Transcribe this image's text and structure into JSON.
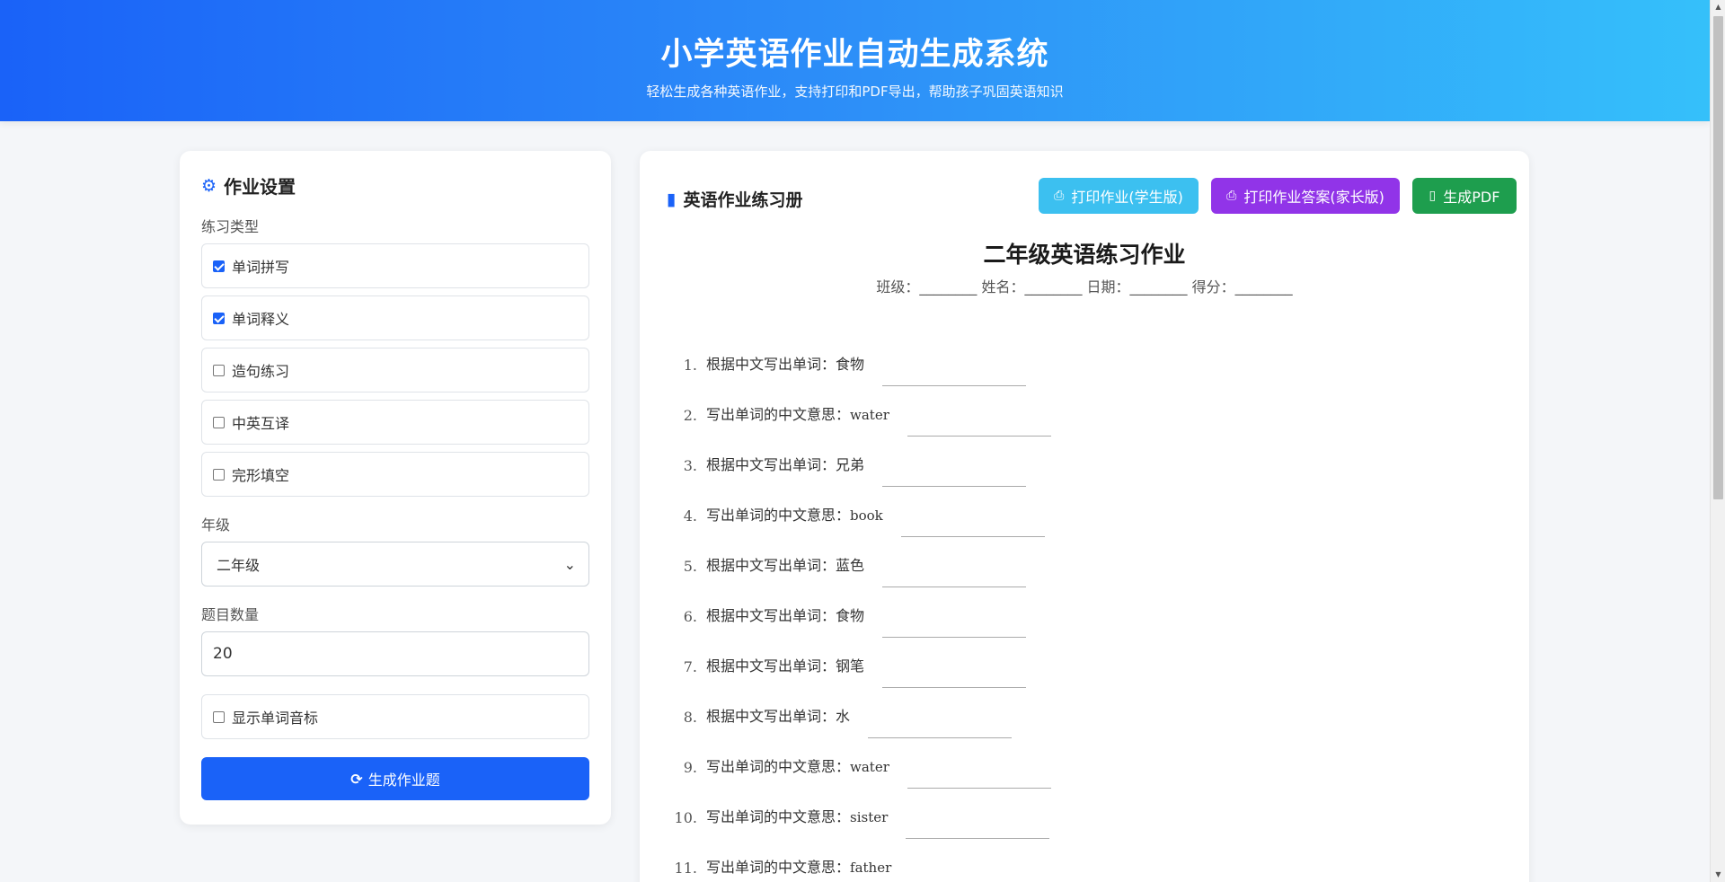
{
  "header": {
    "title": "小学英语作业自动生成系统",
    "subtitle": "轻松生成各种英语作业，支持打印和PDF导出，帮助孩子巩固英语知识"
  },
  "settings": {
    "title": "作业设置",
    "icon": "gears-icon",
    "type_label": "练习类型",
    "types": [
      {
        "label": "单词拼写",
        "checked": true
      },
      {
        "label": "单词释义",
        "checked": true
      },
      {
        "label": "造句练习",
        "checked": false
      },
      {
        "label": "中英互译",
        "checked": false
      },
      {
        "label": "完形填空",
        "checked": false
      }
    ],
    "grade_label": "年级",
    "grade_value": "二年级",
    "count_label": "题目数量",
    "count_value": "20",
    "phonetic_label": "显示单词音标",
    "phonetic_checked": false,
    "generate_label": "生成作业题"
  },
  "worksheet": {
    "title": "英语作业练习册",
    "print_label": "打印作业(学生版)",
    "answer_label": "打印作业答案(家长版)",
    "pdf_label": "生成PDF",
    "heading": "二年级英语练习作业",
    "meta": "班级：________ 姓名：________ 日期：________ 得分：________",
    "questions": [
      {
        "num": "1.",
        "prefix": "根据中文写出单词：",
        "word": "食物",
        "en": false
      },
      {
        "num": "2.",
        "prefix": "写出单词的中文意思：",
        "word": "water",
        "en": true
      },
      {
        "num": "3.",
        "prefix": "根据中文写出单词：",
        "word": "兄弟",
        "en": false
      },
      {
        "num": "4.",
        "prefix": "写出单词的中文意思：",
        "word": "book",
        "en": true
      },
      {
        "num": "5.",
        "prefix": "根据中文写出单词：",
        "word": "蓝色",
        "en": false
      },
      {
        "num": "6.",
        "prefix": "根据中文写出单词：",
        "word": "食物",
        "en": false
      },
      {
        "num": "7.",
        "prefix": "根据中文写出单词：",
        "word": "钢笔",
        "en": false
      },
      {
        "num": "8.",
        "prefix": "根据中文写出单词：",
        "word": "水",
        "en": false
      },
      {
        "num": "9.",
        "prefix": "写出单词的中文意思：",
        "word": "water",
        "en": true
      },
      {
        "num": "10.",
        "prefix": "写出单词的中文意思：",
        "word": "sister",
        "en": true
      },
      {
        "num": "11.",
        "prefix": "写出单词的中文意思：",
        "word": "father",
        "en": true
      }
    ]
  },
  "colors": {
    "primary": "#1a62f8",
    "print_button": "#3cc0f0",
    "answer_button": "#9134e8",
    "pdf_button": "#1e9e4e"
  }
}
